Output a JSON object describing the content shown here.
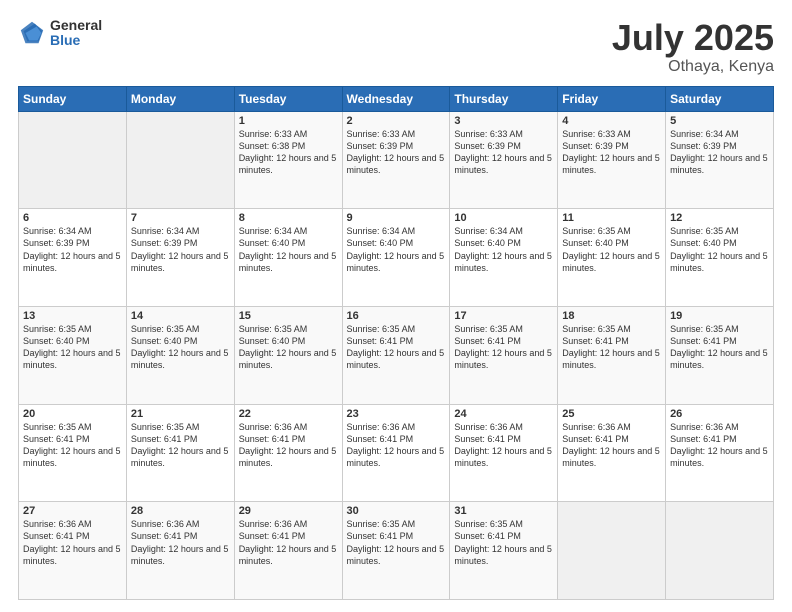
{
  "header": {
    "logo_general": "General",
    "logo_blue": "Blue",
    "title": "July 2025",
    "location": "Othaya, Kenya"
  },
  "weekdays": [
    "Sunday",
    "Monday",
    "Tuesday",
    "Wednesday",
    "Thursday",
    "Friday",
    "Saturday"
  ],
  "weeks": [
    [
      {
        "day": "",
        "empty": true
      },
      {
        "day": "",
        "empty": true
      },
      {
        "day": "1",
        "sunrise": "6:33 AM",
        "sunset": "6:38 PM",
        "daylight": "12 hours and 5 minutes."
      },
      {
        "day": "2",
        "sunrise": "6:33 AM",
        "sunset": "6:39 PM",
        "daylight": "12 hours and 5 minutes."
      },
      {
        "day": "3",
        "sunrise": "6:33 AM",
        "sunset": "6:39 PM",
        "daylight": "12 hours and 5 minutes."
      },
      {
        "day": "4",
        "sunrise": "6:33 AM",
        "sunset": "6:39 PM",
        "daylight": "12 hours and 5 minutes."
      },
      {
        "day": "5",
        "sunrise": "6:34 AM",
        "sunset": "6:39 PM",
        "daylight": "12 hours and 5 minutes."
      }
    ],
    [
      {
        "day": "6",
        "sunrise": "6:34 AM",
        "sunset": "6:39 PM",
        "daylight": "12 hours and 5 minutes."
      },
      {
        "day": "7",
        "sunrise": "6:34 AM",
        "sunset": "6:39 PM",
        "daylight": "12 hours and 5 minutes."
      },
      {
        "day": "8",
        "sunrise": "6:34 AM",
        "sunset": "6:40 PM",
        "daylight": "12 hours and 5 minutes."
      },
      {
        "day": "9",
        "sunrise": "6:34 AM",
        "sunset": "6:40 PM",
        "daylight": "12 hours and 5 minutes."
      },
      {
        "day": "10",
        "sunrise": "6:34 AM",
        "sunset": "6:40 PM",
        "daylight": "12 hours and 5 minutes."
      },
      {
        "day": "11",
        "sunrise": "6:35 AM",
        "sunset": "6:40 PM",
        "daylight": "12 hours and 5 minutes."
      },
      {
        "day": "12",
        "sunrise": "6:35 AM",
        "sunset": "6:40 PM",
        "daylight": "12 hours and 5 minutes."
      }
    ],
    [
      {
        "day": "13",
        "sunrise": "6:35 AM",
        "sunset": "6:40 PM",
        "daylight": "12 hours and 5 minutes."
      },
      {
        "day": "14",
        "sunrise": "6:35 AM",
        "sunset": "6:40 PM",
        "daylight": "12 hours and 5 minutes."
      },
      {
        "day": "15",
        "sunrise": "6:35 AM",
        "sunset": "6:40 PM",
        "daylight": "12 hours and 5 minutes."
      },
      {
        "day": "16",
        "sunrise": "6:35 AM",
        "sunset": "6:41 PM",
        "daylight": "12 hours and 5 minutes."
      },
      {
        "day": "17",
        "sunrise": "6:35 AM",
        "sunset": "6:41 PM",
        "daylight": "12 hours and 5 minutes."
      },
      {
        "day": "18",
        "sunrise": "6:35 AM",
        "sunset": "6:41 PM",
        "daylight": "12 hours and 5 minutes."
      },
      {
        "day": "19",
        "sunrise": "6:35 AM",
        "sunset": "6:41 PM",
        "daylight": "12 hours and 5 minutes."
      }
    ],
    [
      {
        "day": "20",
        "sunrise": "6:35 AM",
        "sunset": "6:41 PM",
        "daylight": "12 hours and 5 minutes."
      },
      {
        "day": "21",
        "sunrise": "6:35 AM",
        "sunset": "6:41 PM",
        "daylight": "12 hours and 5 minutes."
      },
      {
        "day": "22",
        "sunrise": "6:36 AM",
        "sunset": "6:41 PM",
        "daylight": "12 hours and 5 minutes."
      },
      {
        "day": "23",
        "sunrise": "6:36 AM",
        "sunset": "6:41 PM",
        "daylight": "12 hours and 5 minutes."
      },
      {
        "day": "24",
        "sunrise": "6:36 AM",
        "sunset": "6:41 PM",
        "daylight": "12 hours and 5 minutes."
      },
      {
        "day": "25",
        "sunrise": "6:36 AM",
        "sunset": "6:41 PM",
        "daylight": "12 hours and 5 minutes."
      },
      {
        "day": "26",
        "sunrise": "6:36 AM",
        "sunset": "6:41 PM",
        "daylight": "12 hours and 5 minutes."
      }
    ],
    [
      {
        "day": "27",
        "sunrise": "6:36 AM",
        "sunset": "6:41 PM",
        "daylight": "12 hours and 5 minutes."
      },
      {
        "day": "28",
        "sunrise": "6:36 AM",
        "sunset": "6:41 PM",
        "daylight": "12 hours and 5 minutes."
      },
      {
        "day": "29",
        "sunrise": "6:36 AM",
        "sunset": "6:41 PM",
        "daylight": "12 hours and 5 minutes."
      },
      {
        "day": "30",
        "sunrise": "6:35 AM",
        "sunset": "6:41 PM",
        "daylight": "12 hours and 5 minutes."
      },
      {
        "day": "31",
        "sunrise": "6:35 AM",
        "sunset": "6:41 PM",
        "daylight": "12 hours and 5 minutes."
      },
      {
        "day": "",
        "empty": true
      },
      {
        "day": "",
        "empty": true
      }
    ]
  ],
  "labels": {
    "sunrise_prefix": "Sunrise: ",
    "sunset_prefix": "Sunset: ",
    "daylight_prefix": "Daylight: "
  }
}
